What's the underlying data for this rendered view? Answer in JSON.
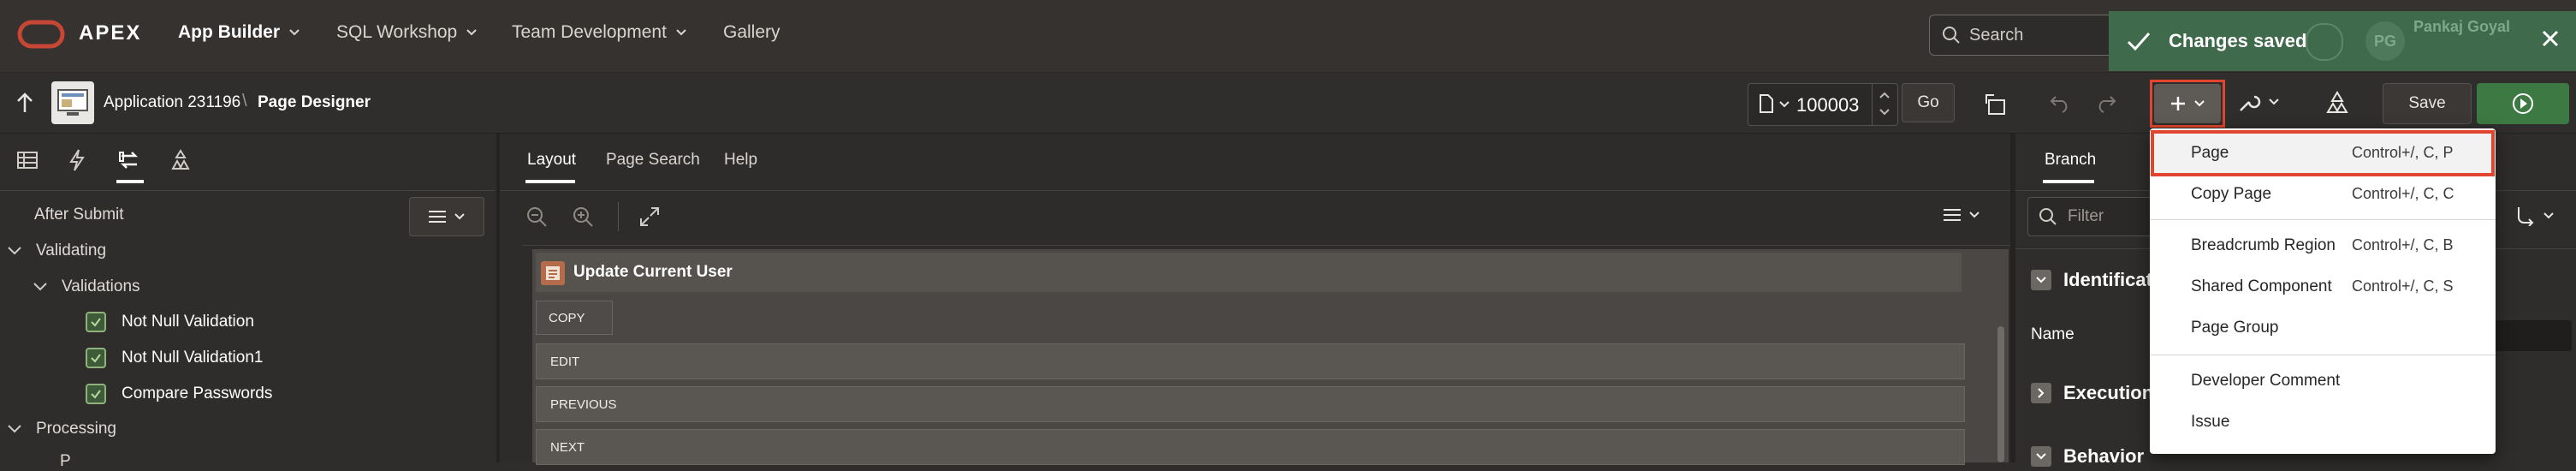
{
  "brand": {
    "name": "APEX",
    "logo_color": "#c74634"
  },
  "nav": {
    "items": [
      {
        "label": "App Builder"
      },
      {
        "label": "SQL Workshop"
      },
      {
        "label": "Team Development"
      },
      {
        "label": "Gallery"
      }
    ],
    "search_placeholder": "Search",
    "user_initials": "PG",
    "user_name": "Pankaj Goyal"
  },
  "toast": {
    "message": "Changes saved",
    "color": "#3f6a4b"
  },
  "toolbar": {
    "app_label": "Application 231196",
    "separator": "\\",
    "page_designer_label": "Page Designer",
    "page_number": "100003",
    "go_label": "Go",
    "save_label": "Save",
    "run_color": "#3d7a43"
  },
  "left_pane": {
    "tree": {
      "after_submit": "After Submit",
      "validating": "Validating",
      "validations": "Validations",
      "items": [
        "Not Null Validation",
        "Not Null Validation1",
        "Compare Passwords"
      ],
      "processing": "Processing",
      "process_cut": "P"
    }
  },
  "center_pane": {
    "tabs": [
      "Layout",
      "Page Search",
      "Help"
    ],
    "region_title": "Update Current User",
    "buttons": [
      "COPY",
      "EDIT",
      "PREVIOUS",
      "NEXT"
    ]
  },
  "right_pane": {
    "tab": "Branch",
    "filter_placeholder": "Filter",
    "sections": [
      "Identification",
      "Execution",
      "Behavior"
    ],
    "name_label": "Name"
  },
  "create_menu": {
    "items": [
      {
        "label": "Page",
        "shortcut": "Control+/, C, P"
      },
      {
        "label": "Copy Page",
        "shortcut": "Control+/, C, C"
      },
      {
        "label": "Breadcrumb Region",
        "shortcut": "Control+/, C, B"
      },
      {
        "label": "Shared Component",
        "shortcut": "Control+/, C, S"
      },
      {
        "label": "Page Group",
        "shortcut": ""
      },
      {
        "label": "Developer Comment",
        "shortcut": ""
      },
      {
        "label": "Issue",
        "shortcut": ""
      }
    ],
    "highlight_color": "#e0452f"
  }
}
